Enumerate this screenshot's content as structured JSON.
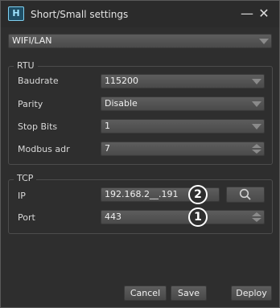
{
  "window": {
    "title": "Short/Small settings",
    "icon_text": "H",
    "minimize_glyph": "—",
    "close_glyph": "✕"
  },
  "connection": {
    "selected": "WIFI/LAN"
  },
  "rtu": {
    "title": "RTU",
    "baudrate": {
      "label": "Baudrate",
      "value": "115200"
    },
    "parity": {
      "label": "Parity",
      "value": "Disable"
    },
    "stop_bits": {
      "label": "Stop Bits",
      "value": "1"
    },
    "modbus_adr": {
      "label": "Modbus adr",
      "value": "7"
    }
  },
  "tcp": {
    "title": "TCP",
    "ip": {
      "label": "IP",
      "value": "192.168.2__.191",
      "badge": "2"
    },
    "port": {
      "label": "Port",
      "value": "443",
      "badge": "1"
    }
  },
  "buttons": {
    "cancel": "Cancel",
    "save": "Save",
    "deploy": "Deploy"
  },
  "icons": {
    "search": "search-icon"
  }
}
